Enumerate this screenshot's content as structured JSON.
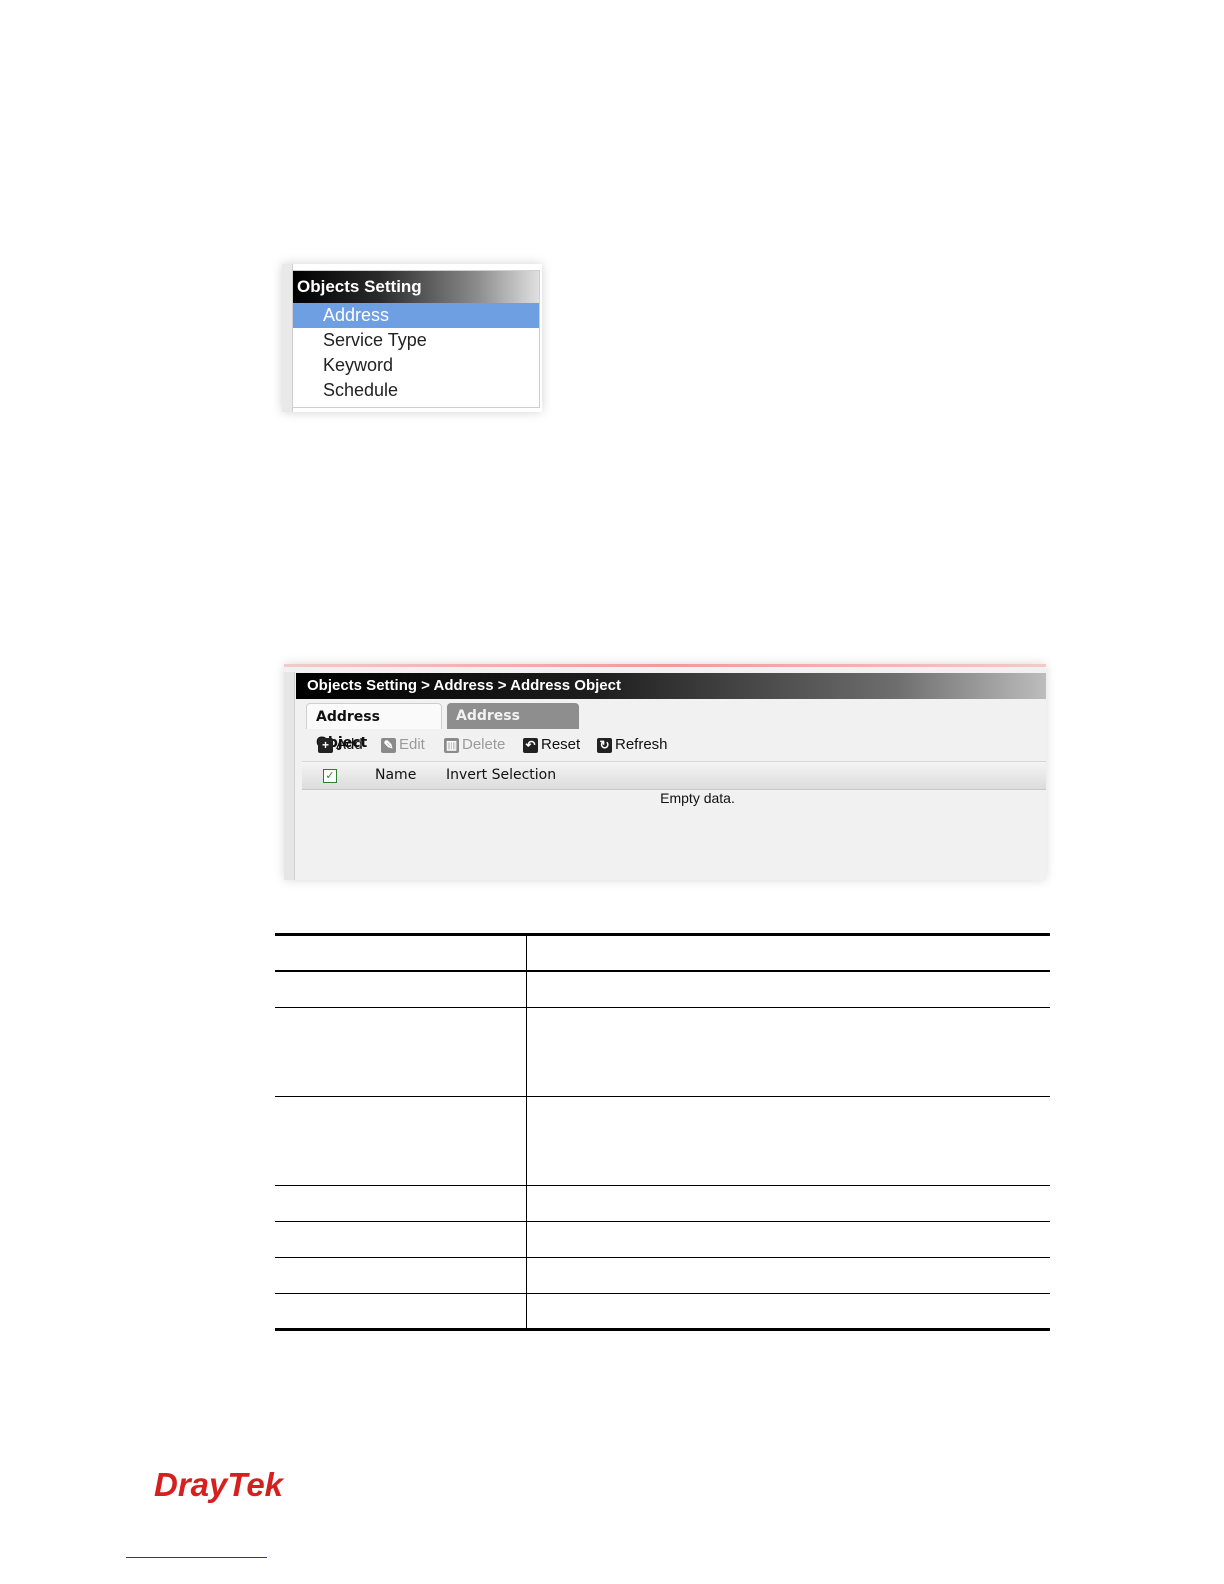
{
  "objects_menu": {
    "title": "Objects Setting",
    "items": [
      {
        "label": "Address",
        "active": true
      },
      {
        "label": "Service Type",
        "active": false
      },
      {
        "label": "Keyword",
        "active": false
      },
      {
        "label": "Schedule",
        "active": false
      }
    ]
  },
  "address_panel": {
    "breadcrumb": "Objects Setting > Address > Address Object",
    "tabs": [
      {
        "label": "Address Object",
        "active": true
      },
      {
        "label": "Address Group",
        "active": false
      }
    ],
    "toolbar": {
      "add": "Add",
      "edit": "Edit",
      "delete": "Delete",
      "reset": "Reset",
      "refresh": "Refresh"
    },
    "grid": {
      "select_all_checked": true,
      "column_name": "Name",
      "invert_selection": "Invert Selection",
      "empty_message": "Empty data."
    }
  },
  "brand": {
    "logo_text": "DrayTek",
    "logo_color": "#d4201f"
  },
  "colors": {
    "menu_active": "#6f9fe3",
    "tab_inactive": "#8e8e8e"
  }
}
